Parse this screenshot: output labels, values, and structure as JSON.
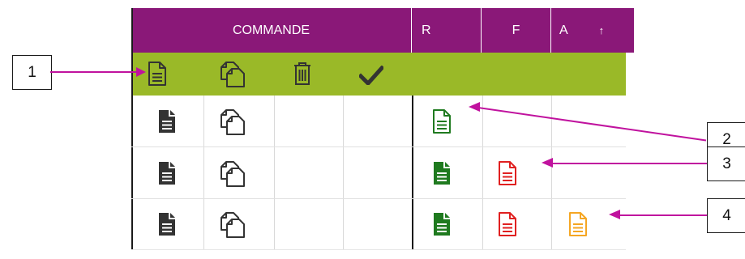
{
  "header": {
    "commande": "COMMANDE",
    "col_r": "R",
    "col_f": "F",
    "col_a": "A",
    "sort_glyph": "↑"
  },
  "callouts": [
    "1",
    "2",
    "3",
    "4"
  ],
  "colors": {
    "header_bg": "#8a1878",
    "toolbar_bg": "#9ab928",
    "leader_line": "#c0129e",
    "doc_dark": "#333333",
    "doc_green": "#1f7a1f",
    "doc_red": "#e02020",
    "doc_orange": "#f5a623"
  },
  "toolbar_icons": [
    "new-document-icon",
    "copy-icon",
    "trash-icon",
    "checkmark-icon"
  ],
  "rows": [
    {
      "r": "green-outline-document-icon",
      "f": "",
      "a": ""
    },
    {
      "r": "green-filled-document-icon",
      "f": "red-outline-document-icon",
      "a": ""
    },
    {
      "r": "green-filled-document-icon",
      "f": "red-outline-document-icon",
      "a": "orange-outline-document-icon"
    }
  ]
}
